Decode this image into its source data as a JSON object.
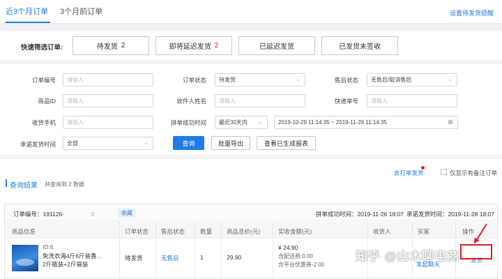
{
  "tabs": [
    {
      "label": "近3个月订单",
      "active": true
    },
    {
      "label": "3个月前订单",
      "active": false
    }
  ],
  "top_link": "设置待发货提醒",
  "quick_filter": {
    "label": "快速筛选订单:",
    "buttons": [
      {
        "label": "待发货",
        "count": "2"
      },
      {
        "label": "即将延迟发货",
        "count": "2"
      },
      {
        "label": "已延迟发货",
        "count": ""
      },
      {
        "label": "已发货未签收",
        "count": ""
      }
    ]
  },
  "filters": {
    "order_no": {
      "label": "订单编号",
      "placeholder": "请输入"
    },
    "order_status": {
      "label": "订单状态",
      "value": "待发货"
    },
    "after_sale": {
      "label": "售后状态",
      "value": "无售后/取消售后"
    },
    "goods_id": {
      "label": "商品ID",
      "placeholder": "请输入"
    },
    "receiver_name": {
      "label": "收件人姓名",
      "placeholder": "请输入"
    },
    "express_no": {
      "label": "快递单号",
      "placeholder": "请输入"
    },
    "receiver_phone": {
      "label": "收货手机",
      "placeholder": "请输入"
    },
    "group_time": {
      "label": "拼单成功时间",
      "range": "最近30天内",
      "dates": "2019-10-29 11:14:35 ~ 2019-11-28 11:14:35"
    },
    "promise_time": {
      "label": "承诺发货时间",
      "value": "全部"
    }
  },
  "actions": {
    "query": "查询",
    "export": "批量导出",
    "view_reports": "查看已生成报表"
  },
  "results": {
    "print_link": "去打单发货",
    "only_remark": "仅显示有备注订单",
    "title": "查询结果",
    "count_text": "共查询到 2 数据"
  },
  "order": {
    "order_no_text": "订单编号：191126-",
    "order_no_suffix": "3",
    "copy_tag": "收藏",
    "group_time": "拼单成功时间：2019-11-26 18:07",
    "promise_time": "承诺发货时间：2019-11-28 18:07",
    "columns": [
      "商品信息",
      "订单状态",
      "售后状态",
      "数量",
      "商品总价(元)",
      "实收金额(元)",
      "收货人",
      "买家",
      "操作"
    ],
    "row": {
      "goods_id": "ID:6",
      "goods_name_1": "免洗衣海4斤6斤装香…",
      "goods_name_2": "2斤瓶装+2斤袋装",
      "status": "待发货",
      "after_sale": "无售后",
      "quantity": "1",
      "total": "29.90",
      "paid": "¥ 24.90",
      "paid_shipping": "含配送费:0.00",
      "paid_discount": "含平台优惠券-2.00",
      "buyer_action": "发起聊天",
      "op": "发货"
    }
  },
  "watermark": "知乎 @山木聊电商",
  "colors": {
    "primary": "#1f7ce6",
    "danger": "#e02020"
  }
}
